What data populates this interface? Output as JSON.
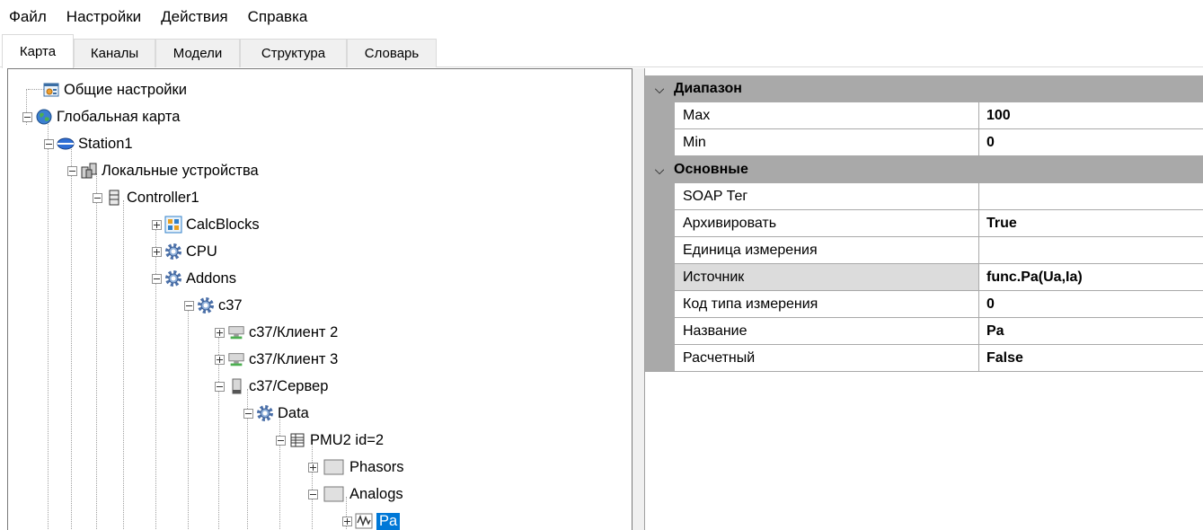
{
  "menu": [
    "Файл",
    "Настройки",
    "Действия",
    "Справка"
  ],
  "tabs": [
    {
      "label": "Карта",
      "active": true
    },
    {
      "label": "Каналы",
      "active": false
    },
    {
      "label": "Модели",
      "active": false
    },
    {
      "label": "Структура",
      "active": false
    },
    {
      "label": "Словарь",
      "active": false
    }
  ],
  "tree": [
    {
      "label": "Общие настройки",
      "icon": "settings-window-icon",
      "expander": "none"
    },
    {
      "label": "Глобальная карта",
      "icon": "globe-icon",
      "expander": "minus"
    },
    {
      "label": "Station1",
      "icon": "station-icon",
      "expander": "minus"
    },
    {
      "label": "Локальные устройства",
      "icon": "local-devices-icon",
      "expander": "minus"
    },
    {
      "label": "Controller1",
      "icon": "controller-icon",
      "expander": "minus"
    },
    {
      "label": "CalcBlocks",
      "icon": "calc-blocks-icon",
      "expander": "plus"
    },
    {
      "label": "CPU",
      "icon": "gear-icon",
      "expander": "plus"
    },
    {
      "label": "Addons",
      "icon": "gear-icon",
      "expander": "minus"
    },
    {
      "label": "c37",
      "icon": "gear-icon",
      "expander": "minus"
    },
    {
      "label": "c37/Клиент 2",
      "icon": "network-client-icon",
      "expander": "plus"
    },
    {
      "label": "c37/Клиент 3",
      "icon": "network-client-icon",
      "expander": "plus"
    },
    {
      "label": "c37/Сервер",
      "icon": "server-icon",
      "expander": "minus"
    },
    {
      "label": "Data",
      "icon": "gear-icon",
      "expander": "minus"
    },
    {
      "label": "PMU2 id=2",
      "icon": "table-icon",
      "expander": "minus"
    },
    {
      "label": "Phasors",
      "icon": "folder-box-icon",
      "expander": "plus"
    },
    {
      "label": "Analogs",
      "icon": "folder-box-icon",
      "expander": "minus"
    },
    {
      "label": "Pa",
      "icon": "waveform-icon",
      "expander": "plus",
      "selected": true
    }
  ],
  "properties": {
    "categories": [
      {
        "label": "Диапазон",
        "rows": [
          {
            "name": "Max",
            "value": "100"
          },
          {
            "name": "Min",
            "value": "0"
          }
        ]
      },
      {
        "label": "Основные",
        "rows": [
          {
            "name": "SOAP Тег",
            "value": ""
          },
          {
            "name": "Архивировать",
            "value": "True"
          },
          {
            "name": "Единица измерения",
            "value": ""
          },
          {
            "name": "Источник",
            "value": "func.Pa(Ua,Ia)",
            "selected": true
          },
          {
            "name": "Код типа измерения",
            "value": "0"
          },
          {
            "name": "Название",
            "value": "Pa"
          },
          {
            "name": "Расчетный",
            "value": "False"
          }
        ]
      }
    ]
  },
  "colors": {
    "selection": "#0078d7",
    "category_bg": "#a9a9a9"
  }
}
